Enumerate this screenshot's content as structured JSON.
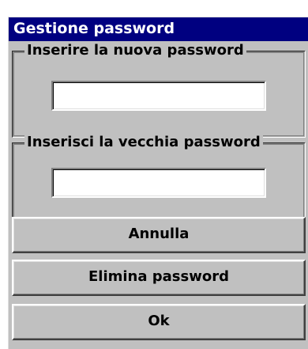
{
  "window": {
    "title": "Gestione password"
  },
  "new_password": {
    "label": "Inserire la nuova password",
    "value": ""
  },
  "old_password": {
    "label": "Inserisci la vecchia password",
    "value": ""
  },
  "buttons": {
    "cancel": "Annulla",
    "delete": "Elimina password",
    "ok": "Ok"
  },
  "colors": {
    "titlebar": "#000080",
    "face": "#c0c0c0"
  }
}
